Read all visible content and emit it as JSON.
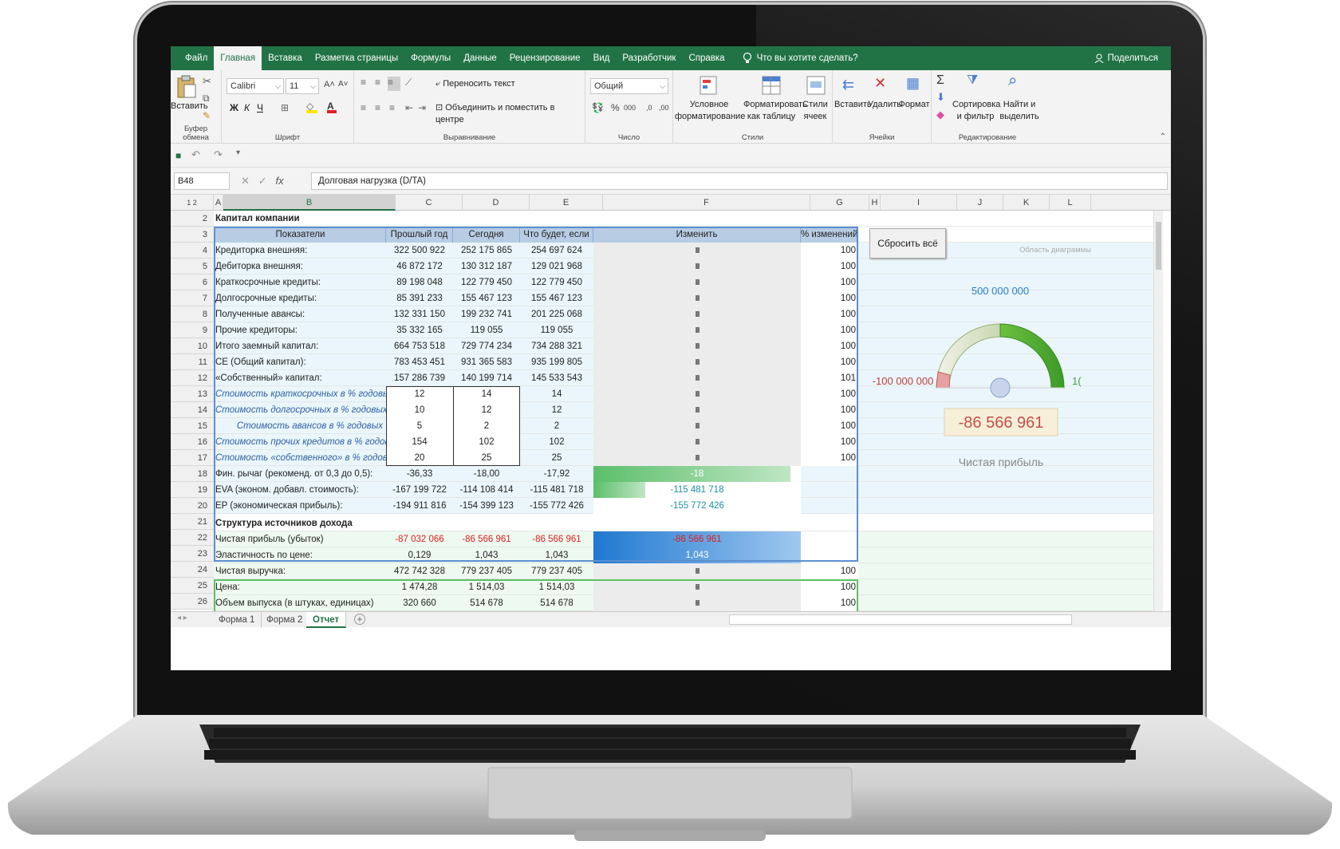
{
  "ribbon_tabs": [
    "Файл",
    "Главная",
    "Вставка",
    "Разметка страницы",
    "Формулы",
    "Данные",
    "Рецензирование",
    "Вид",
    "Разработчик",
    "Справка"
  ],
  "tell_me": "Что вы хотите сделать?",
  "share": "Поделиться",
  "ribbon": {
    "paste": "Вставить",
    "clipboard": "Буфер обмена",
    "font_name": "Calibri",
    "font_size": "11",
    "bold": "Ж",
    "italic": "К",
    "underline": "Ч",
    "font_group": "Шрифт",
    "wrap_text": "Переносить текст",
    "merge_center": "Объединить и поместить в центре",
    "alignment_group": "Выравнивание",
    "number_format": "Общий",
    "number_group": "Число",
    "cond_format_1": "Условное",
    "cond_format_2": "форматирование",
    "format_table_1": "Форматировать",
    "format_table_2": "как таблицу",
    "cell_styles_1": "Стили",
    "cell_styles_2": "ячеек",
    "styles_group": "Стили",
    "insert": "Вставить",
    "delete": "Удалить",
    "format": "Формат",
    "cells_group": "Ячейки",
    "sort_1": "Сортировка",
    "sort_2": "и фильтр",
    "find_1": "Найти и",
    "find_2": "выделить",
    "editing_group": "Редактирование"
  },
  "name_box": "B48",
  "formula": "Долговая нагрузка (D/TA)",
  "columns": [
    "A",
    "B",
    "C",
    "D",
    "E",
    "F",
    "G",
    "H",
    "I",
    "J",
    "K",
    "L"
  ],
  "section1_title": "Капитал компании",
  "header": {
    "b": "Показатели",
    "c": "Прошлый год",
    "d": "Сегодня",
    "e": "Что будет, если",
    "f": "Изменить",
    "g": "% изменений"
  },
  "rows": [
    {
      "n": "4",
      "b": "Кредиторка внешняя:",
      "c": "322 500 922",
      "d": "252 175 865",
      "e": "254 697 624",
      "g": "100"
    },
    {
      "n": "5",
      "b": "Дебиторка внешняя:",
      "c": "46 872 172",
      "d": "130 312 187",
      "e": "129 021 968",
      "g": "100"
    },
    {
      "n": "6",
      "b": "Краткосрочные кредиты:",
      "c": "89 198 048",
      "d": "122 779 450",
      "e": "122 779 450",
      "g": "100"
    },
    {
      "n": "7",
      "b": "Долгосрочные кредиты:",
      "c": "85 391 233",
      "d": "155 467 123",
      "e": "155 467 123",
      "g": "100"
    },
    {
      "n": "8",
      "b": "Полученные авансы:",
      "c": "132 331 150",
      "d": "199 232 741",
      "e": "201 225 068",
      "g": "100"
    },
    {
      "n": "9",
      "b": "Прочие кредиторы:",
      "c": "35 332 165",
      "d": "119 055",
      "e": "119 055",
      "g": "100"
    },
    {
      "n": "10",
      "b": "Итого заемный капитал:",
      "c": "664 753 518",
      "d": "729 774 234",
      "e": "734 288 321",
      "g": "100"
    },
    {
      "n": "11",
      "b": "СЕ (Общий капитал):",
      "c": "783 453 451",
      "d": "931 365 583",
      "e": "935 199 805",
      "g": "100"
    },
    {
      "n": "12",
      "b": "«Собственный» капитал:",
      "c": "157 286 739",
      "d": "140 199 714",
      "e": "145 533 543",
      "g": "101"
    }
  ],
  "italic_rows": [
    {
      "n": "13",
      "b": "Стоимость краткосрочных в % годовых",
      "c": "12",
      "d": "14",
      "e": "14",
      "g": "100"
    },
    {
      "n": "14",
      "b": "Стоимость долгосрочных в % годовых",
      "c": "10",
      "d": "12",
      "e": "12",
      "g": "100"
    },
    {
      "n": "15",
      "b": "Стоимость авансов в % годовых",
      "c": "5",
      "d": "2",
      "e": "2",
      "g": "100"
    },
    {
      "n": "16",
      "b": "Стоимость прочих кредитов в % годовых",
      "c": "154",
      "d": "102",
      "e": "102",
      "g": "100"
    },
    {
      "n": "17",
      "b": "Стоимость «собственного» в % годовых",
      "c": "20",
      "d": "25",
      "e": "25",
      "g": "100"
    }
  ],
  "metric_rows": [
    {
      "n": "18",
      "b": "Фин. рычаг (рекоменд. от 0,3 до 0,5):",
      "c": "-36,33",
      "d": "-18,00",
      "e": "-17,92",
      "f": "-18",
      "fill": 0.95
    },
    {
      "n": "19",
      "b": "EVA (эконом. добавл. стоимость):",
      "c": "-167 199 722",
      "d": "-114 108 414",
      "e": "-115 481 718",
      "f": "-115 481 718",
      "fill": 0.25
    },
    {
      "n": "20",
      "b": "EP (экономическая прибыль):",
      "c": "-194 911 816",
      "d": "-154 399 123",
      "e": "-155 772 426",
      "f": "-155 772 426",
      "fill": 0
    }
  ],
  "section2_title": "Структура источников дохода",
  "section2_rows": [
    {
      "n": "22",
      "b": "Чистая прибыль (убыток)",
      "c": "-87 032 066",
      "d": "-86 566 961",
      "e": "-86 566 961",
      "f": "-86 566 961",
      "g": "",
      "fill": 1
    },
    {
      "n": "23",
      "b": "Эластичность по цене:",
      "c": "0,129",
      "d": "1,043",
      "e": "1,043",
      "f": "1,043",
      "g": "",
      "fill": 1
    },
    {
      "n": "24",
      "b": "Чистая выручка:",
      "c": "472 742 328",
      "d": "779 237 405",
      "e": "779 237 405",
      "f": "",
      "g": "100"
    },
    {
      "n": "25",
      "b": "Цена:",
      "c": "1 474,28",
      "d": "1 514,03",
      "e": "1 514,03",
      "f": "",
      "g": "100"
    },
    {
      "n": "26",
      "b": "Объем выпуска (в штуках, единицах)",
      "c": "320 660",
      "d": "514 678",
      "e": "514 678",
      "f": "",
      "g": "100"
    }
  ],
  "reset_button": "Сбросить всё",
  "chart_area_label": "Область диаграммы",
  "gauge": {
    "max_label": "500 000 000",
    "min_label": "-100 000 000",
    "right_label": "1(",
    "value": "-86 566 961",
    "caption": "Чистая прибыль"
  },
  "sheet_tabs": [
    "Форма 1",
    "Форма 2",
    "Отчет"
  ],
  "colors": {
    "excel_green": "#217346",
    "header_blue": "#b8cce4",
    "gauge_green": "#5fb83a"
  }
}
